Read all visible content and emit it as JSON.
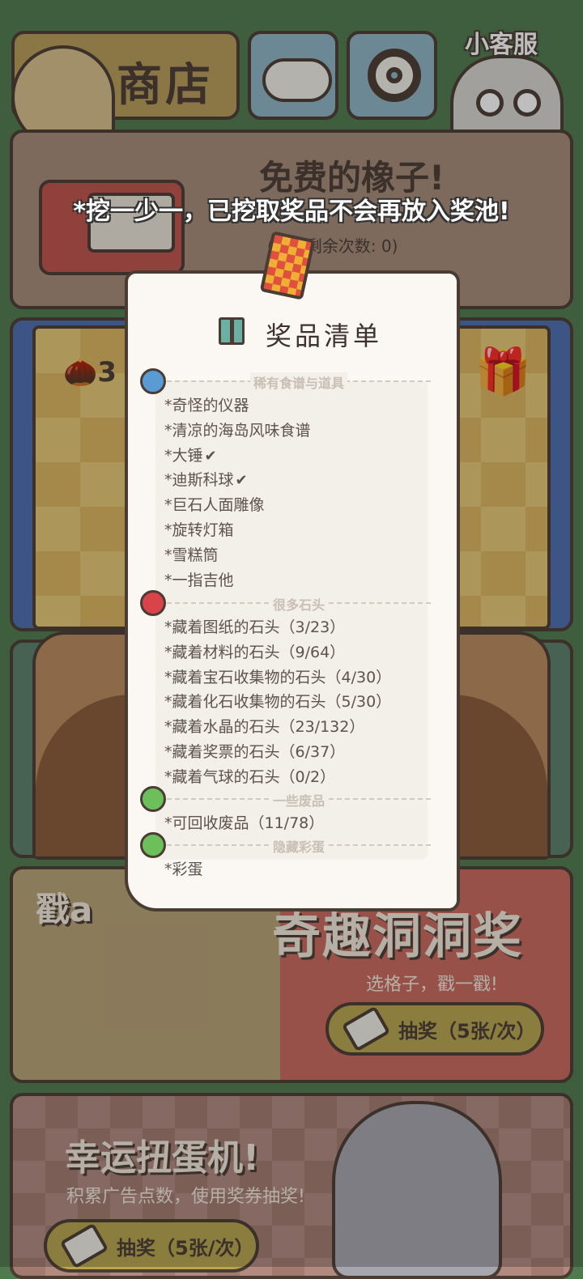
{
  "header": {
    "shop_label": "商店",
    "customer_service_label": "小客服"
  },
  "free_acorn": {
    "title": "免费的橡子!",
    "remaining": "(今日剩余次数: 0)"
  },
  "dig": {
    "acorn_count": "3"
  },
  "notice": "*挖一少一，已挖取奖品不会再放入奖池!",
  "prize_list": {
    "title": "奖品清单",
    "sections": [
      {
        "heading": "稀有食谱与道具",
        "ball_color": "#5b9bd5",
        "items": [
          {
            "text": "*奇怪的仪器",
            "checked": false
          },
          {
            "text": "*清凉的海岛风味食谱",
            "checked": false
          },
          {
            "text": "*大锤",
            "checked": true
          },
          {
            "text": "*迪斯科球",
            "checked": true
          },
          {
            "text": "*巨石人面雕像",
            "checked": false
          },
          {
            "text": "*旋转灯箱",
            "checked": false
          },
          {
            "text": "*雪糕筒",
            "checked": false
          },
          {
            "text": "*一指吉他",
            "checked": false
          }
        ]
      },
      {
        "heading": "很多石头",
        "ball_color": "#d9434a",
        "items": [
          {
            "text": "*藏着图纸的石头（3/23）",
            "checked": false
          },
          {
            "text": "*藏着材料的石头（9/64）",
            "checked": false
          },
          {
            "text": "*藏着宝石收集物的石头（4/30）",
            "checked": false
          },
          {
            "text": "*藏着化石收集物的石头（5/30）",
            "checked": false
          },
          {
            "text": "*藏着水晶的石头（23/132）",
            "checked": false
          },
          {
            "text": "*藏着奖票的石头（6/37）",
            "checked": false
          },
          {
            "text": "*藏着气球的石头（0/2）",
            "checked": false
          }
        ]
      },
      {
        "heading": "一些废品",
        "ball_color": "#6cbf5a",
        "items": [
          {
            "text": "*可回收废品（11/78）",
            "checked": false
          }
        ]
      },
      {
        "heading": "隐藏彩蛋",
        "ball_color": "#6cbf5a",
        "items": [
          {
            "text": "*彩蛋",
            "checked": false
          }
        ]
      }
    ]
  },
  "fun_hole": {
    "poke_text": "戳a",
    "title": "奇趣洞洞奖",
    "subtitle": "选格子，戳一戳!",
    "draw_label": "抽奖（5张/次）"
  },
  "gacha": {
    "title": "幸运扭蛋机!",
    "subtitle": "积累广告点数，使用奖券抽奖!",
    "draw_label": "抽奖（5张/次）"
  },
  "colors": {
    "background": "#4f7a4d",
    "outline": "#4a3b33",
    "sheet": "#fbf8f3"
  }
}
